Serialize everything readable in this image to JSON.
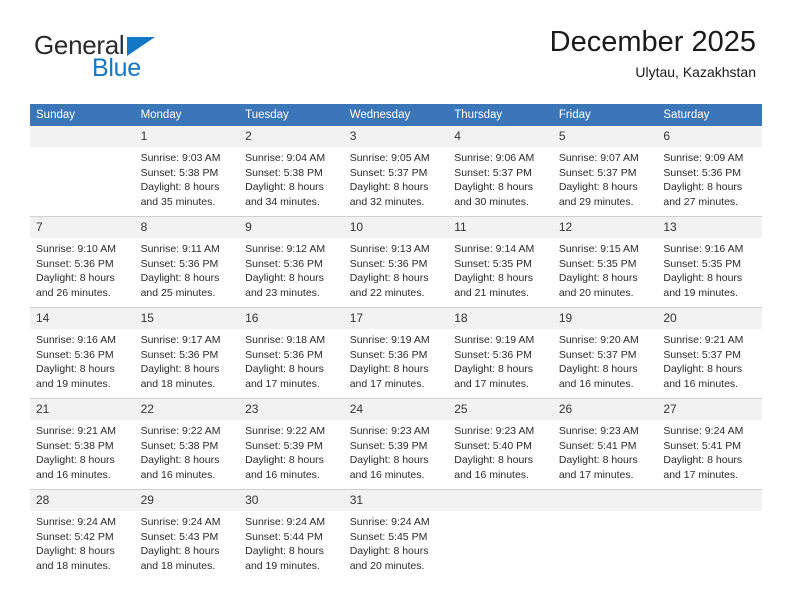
{
  "brand": {
    "name_part1": "General",
    "name_part2": "Blue",
    "triangle_color": "#1277c4",
    "text_color": "#2b2b2b"
  },
  "header": {
    "title": "December 2025",
    "location": "Ulytau, Kazakhstan"
  },
  "colors": {
    "header_row_bg": "#3a76b8",
    "header_row_text": "#ffffff",
    "daynum_bg": "#f2f2f2",
    "row_divider": "#d0d0d0",
    "body_text": "#2a2a2a"
  },
  "weekdays": [
    "Sunday",
    "Monday",
    "Tuesday",
    "Wednesday",
    "Thursday",
    "Friday",
    "Saturday"
  ],
  "weeks": [
    [
      {
        "day": "",
        "sunrise": "",
        "sunset": "",
        "daylight1": "",
        "daylight2": "",
        "empty": true
      },
      {
        "day": "1",
        "sunrise": "Sunrise: 9:03 AM",
        "sunset": "Sunset: 5:38 PM",
        "daylight1": "Daylight: 8 hours",
        "daylight2": "and 35 minutes."
      },
      {
        "day": "2",
        "sunrise": "Sunrise: 9:04 AM",
        "sunset": "Sunset: 5:38 PM",
        "daylight1": "Daylight: 8 hours",
        "daylight2": "and 34 minutes."
      },
      {
        "day": "3",
        "sunrise": "Sunrise: 9:05 AM",
        "sunset": "Sunset: 5:37 PM",
        "daylight1": "Daylight: 8 hours",
        "daylight2": "and 32 minutes."
      },
      {
        "day": "4",
        "sunrise": "Sunrise: 9:06 AM",
        "sunset": "Sunset: 5:37 PM",
        "daylight1": "Daylight: 8 hours",
        "daylight2": "and 30 minutes."
      },
      {
        "day": "5",
        "sunrise": "Sunrise: 9:07 AM",
        "sunset": "Sunset: 5:37 PM",
        "daylight1": "Daylight: 8 hours",
        "daylight2": "and 29 minutes."
      },
      {
        "day": "6",
        "sunrise": "Sunrise: 9:09 AM",
        "sunset": "Sunset: 5:36 PM",
        "daylight1": "Daylight: 8 hours",
        "daylight2": "and 27 minutes."
      }
    ],
    [
      {
        "day": "7",
        "sunrise": "Sunrise: 9:10 AM",
        "sunset": "Sunset: 5:36 PM",
        "daylight1": "Daylight: 8 hours",
        "daylight2": "and 26 minutes."
      },
      {
        "day": "8",
        "sunrise": "Sunrise: 9:11 AM",
        "sunset": "Sunset: 5:36 PM",
        "daylight1": "Daylight: 8 hours",
        "daylight2": "and 25 minutes."
      },
      {
        "day": "9",
        "sunrise": "Sunrise: 9:12 AM",
        "sunset": "Sunset: 5:36 PM",
        "daylight1": "Daylight: 8 hours",
        "daylight2": "and 23 minutes."
      },
      {
        "day": "10",
        "sunrise": "Sunrise: 9:13 AM",
        "sunset": "Sunset: 5:36 PM",
        "daylight1": "Daylight: 8 hours",
        "daylight2": "and 22 minutes."
      },
      {
        "day": "11",
        "sunrise": "Sunrise: 9:14 AM",
        "sunset": "Sunset: 5:35 PM",
        "daylight1": "Daylight: 8 hours",
        "daylight2": "and 21 minutes."
      },
      {
        "day": "12",
        "sunrise": "Sunrise: 9:15 AM",
        "sunset": "Sunset: 5:35 PM",
        "daylight1": "Daylight: 8 hours",
        "daylight2": "and 20 minutes."
      },
      {
        "day": "13",
        "sunrise": "Sunrise: 9:16 AM",
        "sunset": "Sunset: 5:35 PM",
        "daylight1": "Daylight: 8 hours",
        "daylight2": "and 19 minutes."
      }
    ],
    [
      {
        "day": "14",
        "sunrise": "Sunrise: 9:16 AM",
        "sunset": "Sunset: 5:36 PM",
        "daylight1": "Daylight: 8 hours",
        "daylight2": "and 19 minutes."
      },
      {
        "day": "15",
        "sunrise": "Sunrise: 9:17 AM",
        "sunset": "Sunset: 5:36 PM",
        "daylight1": "Daylight: 8 hours",
        "daylight2": "and 18 minutes."
      },
      {
        "day": "16",
        "sunrise": "Sunrise: 9:18 AM",
        "sunset": "Sunset: 5:36 PM",
        "daylight1": "Daylight: 8 hours",
        "daylight2": "and 17 minutes."
      },
      {
        "day": "17",
        "sunrise": "Sunrise: 9:19 AM",
        "sunset": "Sunset: 5:36 PM",
        "daylight1": "Daylight: 8 hours",
        "daylight2": "and 17 minutes."
      },
      {
        "day": "18",
        "sunrise": "Sunrise: 9:19 AM",
        "sunset": "Sunset: 5:36 PM",
        "daylight1": "Daylight: 8 hours",
        "daylight2": "and 17 minutes."
      },
      {
        "day": "19",
        "sunrise": "Sunrise: 9:20 AM",
        "sunset": "Sunset: 5:37 PM",
        "daylight1": "Daylight: 8 hours",
        "daylight2": "and 16 minutes."
      },
      {
        "day": "20",
        "sunrise": "Sunrise: 9:21 AM",
        "sunset": "Sunset: 5:37 PM",
        "daylight1": "Daylight: 8 hours",
        "daylight2": "and 16 minutes."
      }
    ],
    [
      {
        "day": "21",
        "sunrise": "Sunrise: 9:21 AM",
        "sunset": "Sunset: 5:38 PM",
        "daylight1": "Daylight: 8 hours",
        "daylight2": "and 16 minutes."
      },
      {
        "day": "22",
        "sunrise": "Sunrise: 9:22 AM",
        "sunset": "Sunset: 5:38 PM",
        "daylight1": "Daylight: 8 hours",
        "daylight2": "and 16 minutes."
      },
      {
        "day": "23",
        "sunrise": "Sunrise: 9:22 AM",
        "sunset": "Sunset: 5:39 PM",
        "daylight1": "Daylight: 8 hours",
        "daylight2": "and 16 minutes."
      },
      {
        "day": "24",
        "sunrise": "Sunrise: 9:23 AM",
        "sunset": "Sunset: 5:39 PM",
        "daylight1": "Daylight: 8 hours",
        "daylight2": "and 16 minutes."
      },
      {
        "day": "25",
        "sunrise": "Sunrise: 9:23 AM",
        "sunset": "Sunset: 5:40 PM",
        "daylight1": "Daylight: 8 hours",
        "daylight2": "and 16 minutes."
      },
      {
        "day": "26",
        "sunrise": "Sunrise: 9:23 AM",
        "sunset": "Sunset: 5:41 PM",
        "daylight1": "Daylight: 8 hours",
        "daylight2": "and 17 minutes."
      },
      {
        "day": "27",
        "sunrise": "Sunrise: 9:24 AM",
        "sunset": "Sunset: 5:41 PM",
        "daylight1": "Daylight: 8 hours",
        "daylight2": "and 17 minutes."
      }
    ],
    [
      {
        "day": "28",
        "sunrise": "Sunrise: 9:24 AM",
        "sunset": "Sunset: 5:42 PM",
        "daylight1": "Daylight: 8 hours",
        "daylight2": "and 18 minutes."
      },
      {
        "day": "29",
        "sunrise": "Sunrise: 9:24 AM",
        "sunset": "Sunset: 5:43 PM",
        "daylight1": "Daylight: 8 hours",
        "daylight2": "and 18 minutes."
      },
      {
        "day": "30",
        "sunrise": "Sunrise: 9:24 AM",
        "sunset": "Sunset: 5:44 PM",
        "daylight1": "Daylight: 8 hours",
        "daylight2": "and 19 minutes."
      },
      {
        "day": "31",
        "sunrise": "Sunrise: 9:24 AM",
        "sunset": "Sunset: 5:45 PM",
        "daylight1": "Daylight: 8 hours",
        "daylight2": "and 20 minutes."
      },
      {
        "day": "",
        "sunrise": "",
        "sunset": "",
        "daylight1": "",
        "daylight2": "",
        "empty": true
      },
      {
        "day": "",
        "sunrise": "",
        "sunset": "",
        "daylight1": "",
        "daylight2": "",
        "empty": true
      },
      {
        "day": "",
        "sunrise": "",
        "sunset": "",
        "daylight1": "",
        "daylight2": "",
        "empty": true
      }
    ]
  ]
}
